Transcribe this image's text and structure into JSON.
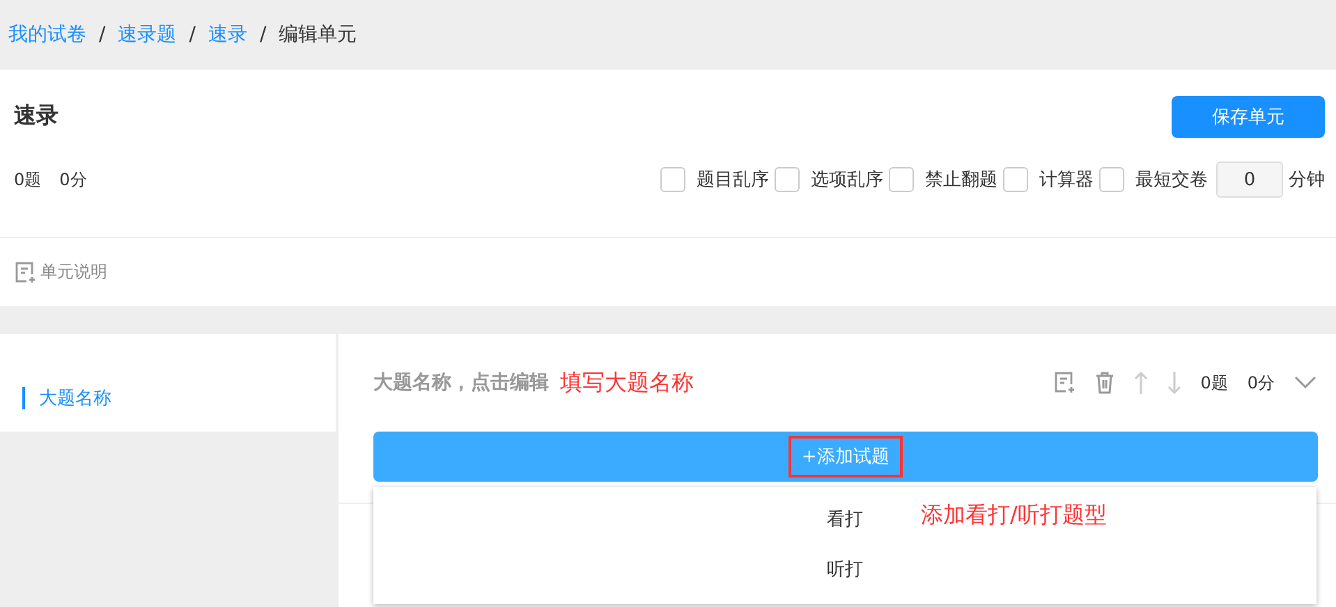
{
  "breadcrumb": [
    {
      "label": "我的试卷",
      "link": true
    },
    {
      "label": "速录题",
      "link": true
    },
    {
      "label": "速录",
      "link": true
    },
    {
      "label": "编辑单元",
      "link": false
    }
  ],
  "separator": "/",
  "unit": {
    "title": "速录",
    "save_button": "保存单元",
    "question_count": "0题",
    "score": "0分",
    "options": [
      {
        "label": "题目乱序",
        "checked": false
      },
      {
        "label": "选项乱序",
        "checked": false
      },
      {
        "label": "禁止翻题",
        "checked": false
      },
      {
        "label": "计算器",
        "checked": false
      },
      {
        "label": "最短交卷",
        "checked": false
      }
    ],
    "min_time": {
      "value": "0",
      "unit": "分钟"
    },
    "description_link": "单元说明"
  },
  "sidebar": {
    "items": [
      {
        "label": "大题名称",
        "selected": true
      }
    ]
  },
  "section": {
    "title": "大题名称，点击编辑",
    "annotation": "填写大题名称",
    "question_count": "0题",
    "score": "0分",
    "expanded": false,
    "add_button": {
      "label": "+添加试题",
      "highlighted": true
    },
    "menu": {
      "items": [
        "看打",
        "听打"
      ],
      "annotation": "添加看打/听打题型"
    }
  }
}
